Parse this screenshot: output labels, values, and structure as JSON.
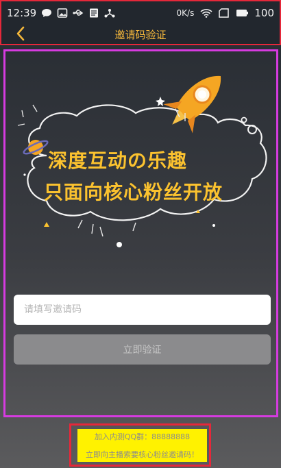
{
  "status_bar": {
    "time": "12:39",
    "net_speed": "0K/s",
    "battery": "100",
    "left_icons": [
      "chat-bubble-icon",
      "image-icon",
      "usb-icon",
      "document-icon",
      "share-icon"
    ],
    "right_icons": [
      "wifi-icon",
      "signal-icon",
      "battery-icon"
    ]
  },
  "nav": {
    "title": "邀请码验证",
    "back_icon": "chevron-left-icon",
    "accent_color": "#f4b73b"
  },
  "banner": {
    "line1": "深度互动の乐趣",
    "line2": "只面向核心粉丝开放",
    "text_color": "#fbc22f",
    "decorations": [
      "rocket-icon",
      "planet-icon",
      "cloud-outline",
      "star-icon"
    ]
  },
  "form": {
    "invite_placeholder": "请填写邀请码",
    "invite_value": "",
    "verify_label": "立即验证"
  },
  "footer": {
    "qq_group": "加入内测QQ群：88888888",
    "hint": "立即向主播索要核心粉丝邀请码！"
  }
}
